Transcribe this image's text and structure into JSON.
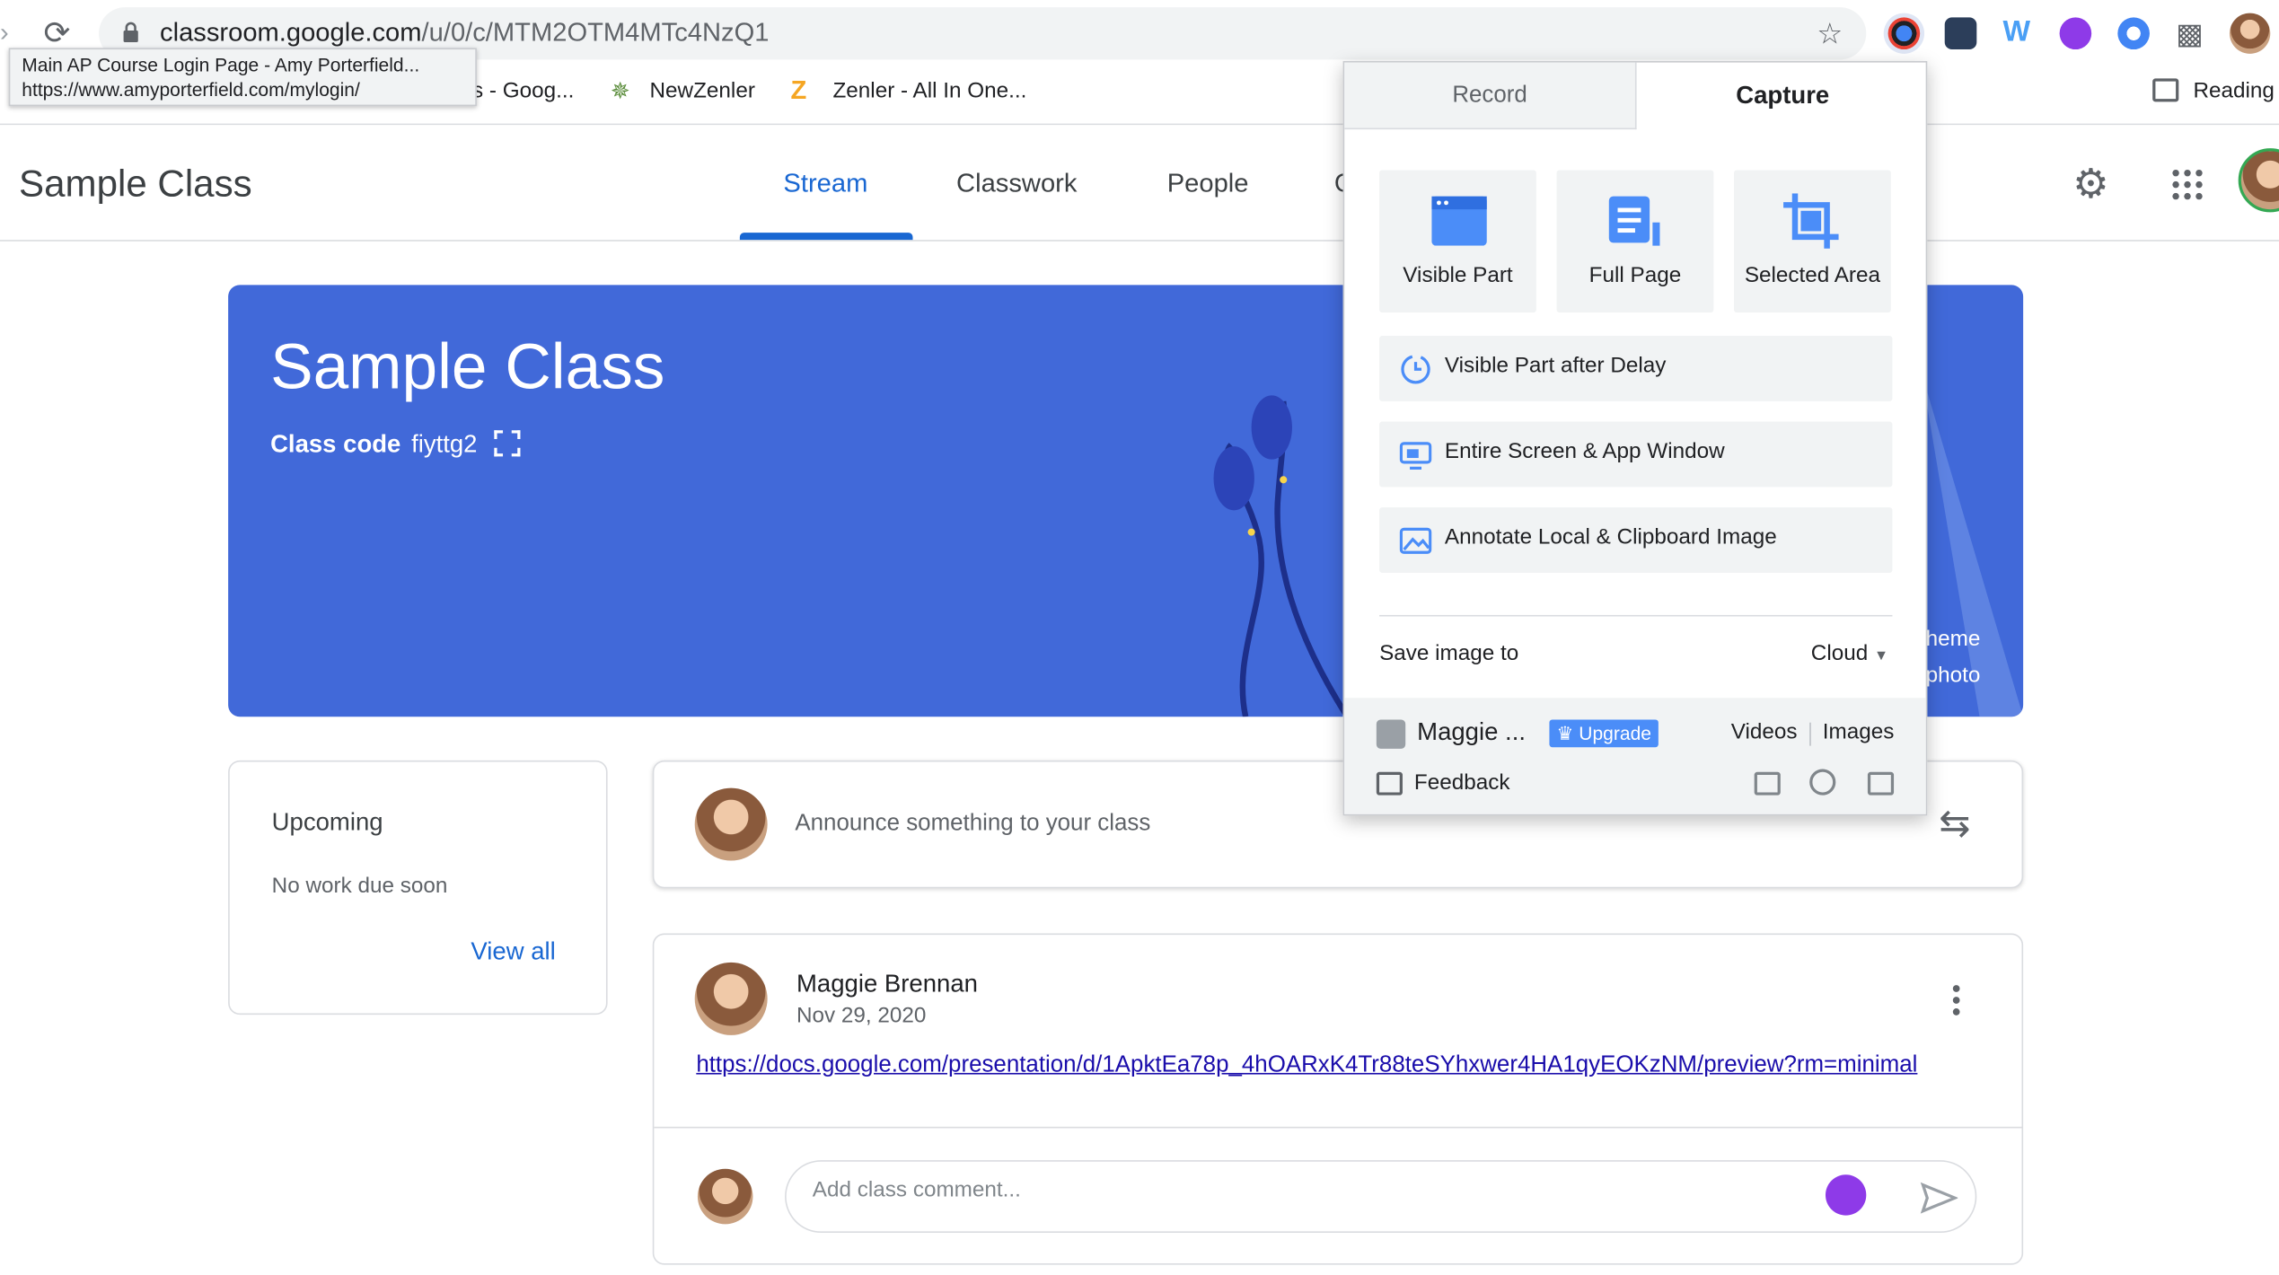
{
  "browser": {
    "url_host": "classroom.google.com",
    "url_path": "/u/0/c/MTM2OTM4MTc4NzQ1",
    "tooltip_title": "Main AP Course Login Page - Amy Porterfield...",
    "tooltip_url": "https://www.amyporterfield.com/mylogin/",
    "bookmarks": [
      "s - Goog...",
      "NewZenler",
      "Zenler - All In One..."
    ],
    "reading_list": "Reading"
  },
  "classroom": {
    "class_name": "Sample Class",
    "tabs": [
      "Stream",
      "Classwork",
      "People",
      "G"
    ],
    "banner_title": "Sample Class",
    "class_code_label": "Class code",
    "class_code": "fiyttg2",
    "banner_side_text": [
      "heme",
      "photo"
    ],
    "upcoming": {
      "title": "Upcoming",
      "empty": "No work due soon",
      "view_all": "View all"
    },
    "announce_placeholder": "Announce something to your class",
    "post": {
      "author": "Maggie Brennan",
      "date": "Nov 29, 2020",
      "link": "https://docs.google.com/presentation/d/1ApktEa78p_4hOARxK4Tr88teSYhxwer4HA1qyEOKzNM/preview?rm=minimal",
      "comment_placeholder": "Add class comment..."
    }
  },
  "popup": {
    "tabs": [
      "Record",
      "Capture"
    ],
    "active_tab": "Capture",
    "big_buttons": [
      "Visible Part",
      "Full Page",
      "Selected Area"
    ],
    "row_buttons": [
      "Visible Part after Delay",
      "Entire Screen & App Window",
      "Annotate Local & Clipboard Image"
    ],
    "save_label": "Save image to",
    "save_value": "Cloud",
    "user_name": "Maggie ...",
    "upgrade": "Upgrade",
    "videos": "Videos",
    "images": "Images",
    "feedback": "Feedback",
    "accent": "#4b8df8"
  }
}
